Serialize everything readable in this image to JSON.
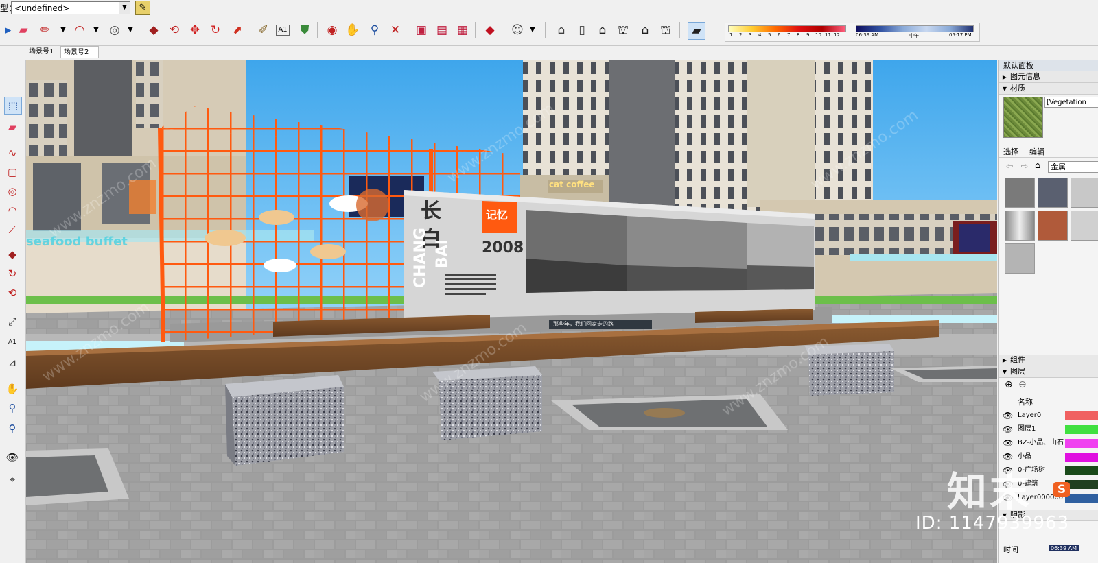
{
  "toolbar": {
    "type_label": "型：",
    "type_value": "<undefined>",
    "icons": [
      "select-icon",
      "eraser-icon",
      "pencil-icon",
      "arc-icon",
      "circle-icon",
      "push-pull-icon",
      "follow-me-icon",
      "move-icon",
      "rotate-icon",
      "scale-icon",
      "tape-measure-icon",
      "text-icon",
      "paint-bucket-icon",
      "orbit-icon",
      "pan-icon",
      "zoom-icon",
      "zoom-extents-icon",
      "component-icon",
      "warehouse-icon",
      "share-icon",
      "ruby-icon",
      "user-icon",
      "iso-view-icon",
      "front-view-icon",
      "top-view-icon",
      "right-view-icon",
      "back-view-icon",
      "left-view-icon",
      "shadow-toggle-icon"
    ]
  },
  "shadow": {
    "months": [
      "1",
      "2",
      "3",
      "4",
      "5",
      "6",
      "7",
      "8",
      "9",
      "10",
      "11",
      "12"
    ],
    "time_start": "06:39 AM",
    "time_mid": "中午",
    "time_end": "05:17 PM"
  },
  "tabs": [
    "场景号1",
    "场景号2"
  ],
  "scene": {
    "sign_cn": "长 白",
    "sign_en_1": "CHANG",
    "sign_en_2": "BAI",
    "year": "2008",
    "logo": "记忆",
    "plaque": "那些年，我们回家走的路",
    "shop": "cat coffee",
    "buffet": "seafood buffet"
  },
  "panel": {
    "default_tray": "默认面板",
    "entity_info": "图元信息",
    "materials": "材质",
    "material_name": "[Vegetation",
    "select_tab": "选择",
    "edit_tab": "编辑",
    "library": "金属",
    "components": "组件",
    "layers": "图层",
    "name_header": "名称",
    "layer_rows": [
      {
        "name": "Layer0",
        "color": "#f06060"
      },
      {
        "name": "图层1",
        "color": "#40e040"
      },
      {
        "name": "BZ-小品、山石",
        "color": "#f040f0"
      },
      {
        "name": "小品",
        "color": "#e010e0"
      },
      {
        "name": "0-广场树",
        "color": "#1a4a1a"
      },
      {
        "name": "0-建筑",
        "color": "#204020"
      },
      {
        "name": "Layer000000",
        "color": "#3060a0"
      }
    ],
    "shadows": "阴影",
    "time_label": "时间",
    "time_value": "06:39 AM"
  },
  "watermark": {
    "zh": "知末",
    "id": "ID: 1147939963",
    "site": "www.znzmo.com"
  }
}
